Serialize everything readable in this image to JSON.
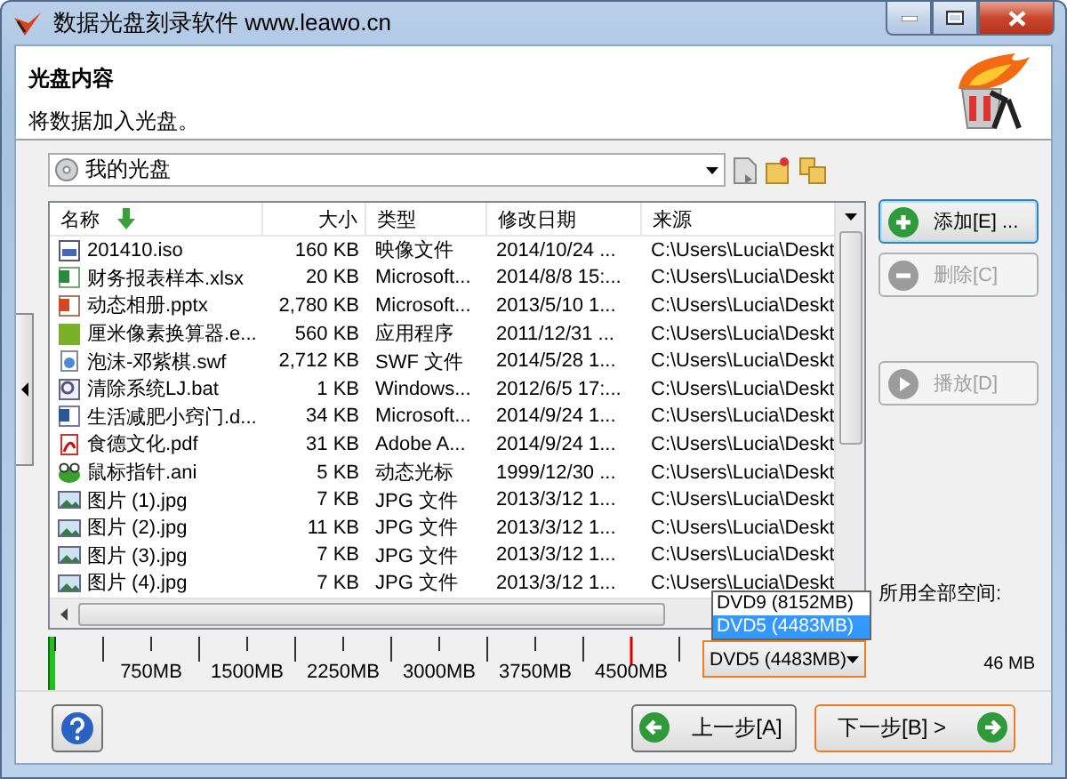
{
  "window": {
    "title": "数据光盘刻录软件 www.leawo.cn"
  },
  "header": {
    "title": "光盘内容",
    "subtitle": "将数据加入光盘。"
  },
  "location": {
    "value": "我的光盘"
  },
  "file_list": {
    "columns": [
      {
        "label": "名称",
        "sorted": true
      },
      {
        "label": "大小",
        "sorted": false
      },
      {
        "label": "类型",
        "sorted": false
      },
      {
        "label": "修改日期",
        "sorted": false
      },
      {
        "label": "来源",
        "sorted": false
      }
    ],
    "rows": [
      {
        "kind": "iso",
        "name": "201410.iso",
        "size": "160 KB",
        "type": "映像文件",
        "date": "2014/10/24 ...",
        "source": "C:\\Users\\Lucia\\Deskt"
      },
      {
        "kind": "excel",
        "name": "财务报表样本.xlsx",
        "size": "20 KB",
        "type": "Microsoft...",
        "date": "2014/8/8 15:...",
        "source": "C:\\Users\\Lucia\\Deskt"
      },
      {
        "kind": "powerpoint",
        "name": "动态相册.pptx",
        "size": "2,780 KB",
        "type": "Microsoft...",
        "date": "2013/5/10 1...",
        "source": "C:\\Users\\Lucia\\Deskt"
      },
      {
        "kind": "app",
        "name": "厘米像素换算器.e...",
        "size": "560 KB",
        "type": "应用程序",
        "date": "2011/12/31 ...",
        "source": "C:\\Users\\Lucia\\Deskt"
      },
      {
        "kind": "swf",
        "name": "泡沫-邓紫棋.swf",
        "size": "2,712 KB",
        "type": "SWF 文件",
        "date": "2014/5/28 1...",
        "source": "C:\\Users\\Lucia\\Deskt"
      },
      {
        "kind": "batch",
        "name": "清除系统LJ.bat",
        "size": "1 KB",
        "type": "Windows...",
        "date": "2012/6/5 17:...",
        "source": "C:\\Users\\Lucia\\Deskt"
      },
      {
        "kind": "word",
        "name": "生活减肥小窍门.d...",
        "size": "34 KB",
        "type": "Microsoft...",
        "date": "2014/9/24 1...",
        "source": "C:\\Users\\Lucia\\Deskt"
      },
      {
        "kind": "pdf",
        "name": "食德文化.pdf",
        "size": "31 KB",
        "type": "Adobe A...",
        "date": "2014/9/24 1...",
        "source": "C:\\Users\\Lucia\\Deskt"
      },
      {
        "kind": "cursor",
        "name": "鼠标指针.ani",
        "size": "5 KB",
        "type": "动态光标",
        "date": "1999/12/30 ...",
        "source": "C:\\Users\\Lucia\\Deskt"
      },
      {
        "kind": "image",
        "name": "图片 (1).jpg",
        "size": "7 KB",
        "type": "JPG 文件",
        "date": "2013/3/12 1...",
        "source": "C:\\Users\\Lucia\\Deskt"
      },
      {
        "kind": "image",
        "name": "图片 (2).jpg",
        "size": "11 KB",
        "type": "JPG 文件",
        "date": "2013/3/12 1...",
        "source": "C:\\Users\\Lucia\\Deskt"
      },
      {
        "kind": "image",
        "name": "图片 (3).jpg",
        "size": "7 KB",
        "type": "JPG 文件",
        "date": "2013/3/12 1...",
        "source": "C:\\Users\\Lucia\\Deskt"
      },
      {
        "kind": "image",
        "name": "图片 (4).jpg",
        "size": "7 KB",
        "type": "JPG 文件",
        "date": "2013/3/12 1...",
        "source": "C:\\Users\\Lucia\\Deskt"
      }
    ]
  },
  "side_buttons": [
    {
      "kind": "add",
      "label": "添加[E] ...",
      "disabled": false
    },
    {
      "kind": "remove",
      "label": "删除[C]",
      "disabled": true
    },
    {
      "kind": "play",
      "label": "播放[D]",
      "disabled": true
    }
  ],
  "space": {
    "label": "所用全部空间:",
    "used": "46 MB",
    "level": 0.01
  },
  "ruler": {
    "ticks": [
      "750MB",
      "1500MB",
      "2250MB",
      "3000MB",
      "3750MB",
      "4500MB"
    ]
  },
  "disc_type": {
    "value": "DVD5 (4483MB)",
    "options": [
      {
        "label": "DVD9 (8152MB)",
        "selected": false
      },
      {
        "label": "DVD5 (4483MB)",
        "selected": true
      }
    ]
  },
  "footer": {
    "buttons": [
      {
        "kind": "back",
        "label": "上一步[A]",
        "default": false
      },
      {
        "kind": "next",
        "label": "下一步[B] >",
        "default": true
      }
    ]
  }
}
